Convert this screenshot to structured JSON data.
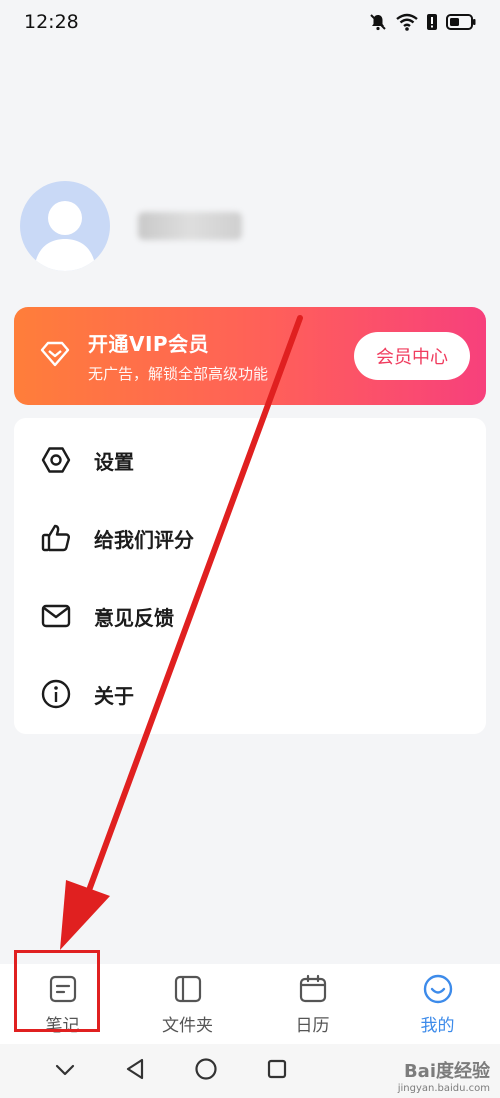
{
  "status": {
    "time": "12:28"
  },
  "profile": {
    "username": ""
  },
  "vip": {
    "title": "开通VIP会员",
    "subtitle": "无广告，解锁全部高级功能",
    "button_label": "会员中心"
  },
  "menu": {
    "items": [
      {
        "label": "设置",
        "icon": "settings-hexagon-icon"
      },
      {
        "label": "给我们评分",
        "icon": "thumbs-up-icon"
      },
      {
        "label": "意见反馈",
        "icon": "mail-icon"
      },
      {
        "label": "关于",
        "icon": "info-icon"
      }
    ]
  },
  "tabs": [
    {
      "label": "笔记",
      "icon": "note-icon",
      "active": false
    },
    {
      "label": "文件夹",
      "icon": "folder-icon",
      "active": false
    },
    {
      "label": "日历",
      "icon": "calendar-icon",
      "active": false
    },
    {
      "label": "我的",
      "icon": "smile-icon",
      "active": true
    }
  ],
  "watermark": {
    "brand": "Bai度经验",
    "url": "jingyan.baidu.com"
  },
  "colors": {
    "accent": "#3d8bea",
    "vip_gradient_start": "#ff7e3a",
    "vip_gradient_end": "#f7407c",
    "annotation": "#e02020"
  }
}
